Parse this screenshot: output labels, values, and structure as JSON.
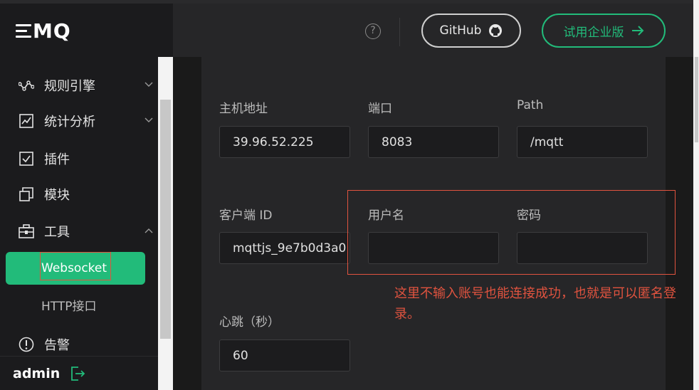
{
  "brand": {
    "logo_text": "MQ"
  },
  "sidebar": {
    "items": [
      {
        "label": "规则引擎",
        "icon": "rule-engine-icon"
      },
      {
        "label": "统计分析",
        "icon": "chart-icon"
      },
      {
        "label": "插件",
        "icon": "plugin-icon"
      },
      {
        "label": "模块",
        "icon": "module-icon"
      },
      {
        "label": "工具",
        "icon": "toolbox-icon"
      },
      {
        "label": "告警",
        "icon": "alarm-icon"
      }
    ],
    "sub_items": [
      {
        "label": "Websocket",
        "active": true
      },
      {
        "label": "HTTP接口",
        "active": false
      }
    ],
    "user": "admin"
  },
  "header": {
    "github_label": "GitHub",
    "enterprise_label": "试用企业版",
    "help_glyph": "?"
  },
  "form": {
    "host_label": "主机地址",
    "host_value": "39.96.52.225",
    "port_label": "端口",
    "port_value": "8083",
    "path_label": "Path",
    "path_value": "/mqtt",
    "client_id_label": "客户端 ID",
    "client_id_value": "mqttjs_9e7b0d3a0",
    "username_label": "用户名",
    "username_value": "",
    "password_label": "密码",
    "password_value": "",
    "keepalive_label": "心跳（秒）",
    "keepalive_value": "60"
  },
  "annotation": "这里不输入账号也能连接成功，也就是可以匿名登录。",
  "colors": {
    "accent": "#22bb7a",
    "annotation": "#e0533f"
  }
}
